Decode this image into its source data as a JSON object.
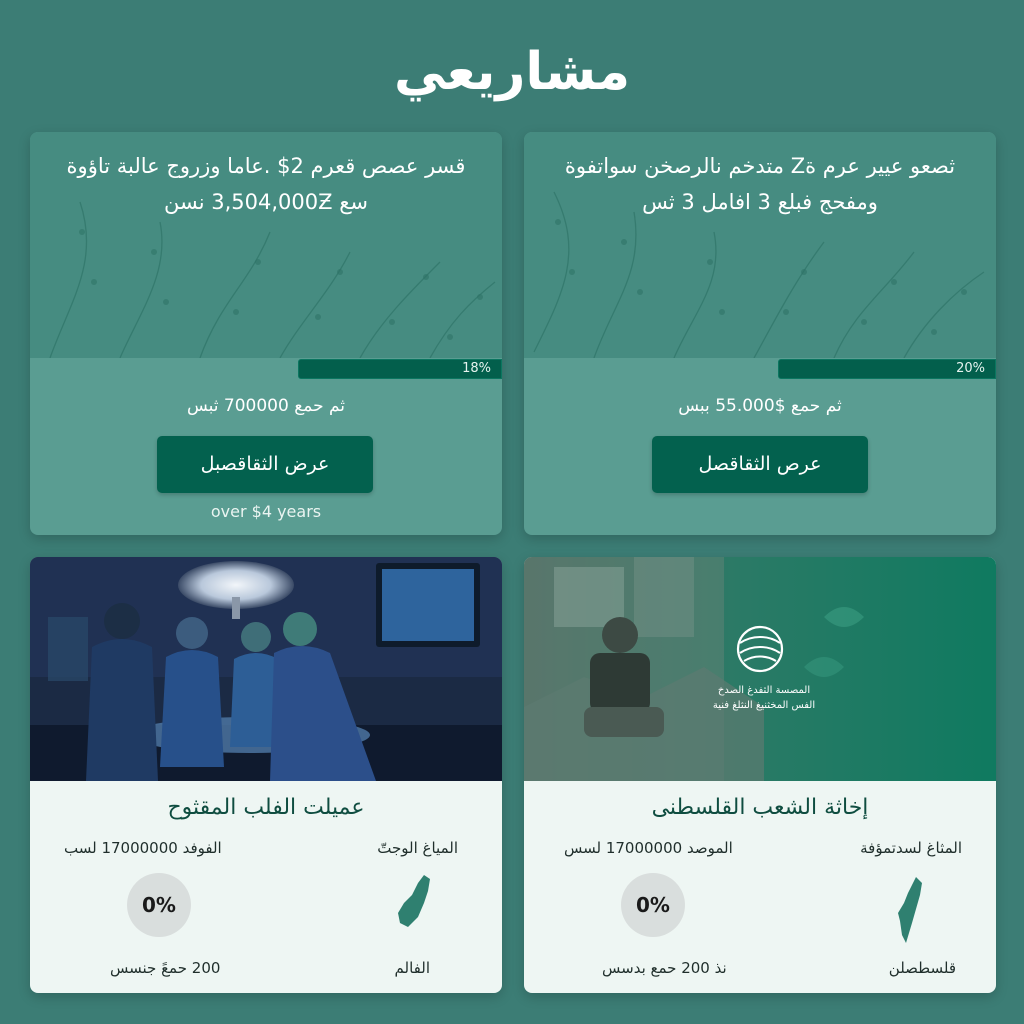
{
  "page": {
    "title": "مشاريعي"
  },
  "projects": [
    {
      "heading": "ثصعو عيير عرم ةZ متدخم نالرصخن سواتفوة ومفحج فبلع 3 افامل 3 ثس",
      "progress_label": "20%",
      "progress_percent": 20,
      "collected": "ثم حمع $55.000 ببس",
      "button_label": "عرص الثقاقصل"
    },
    {
      "heading": "قسر عصص قعرم 2$ .عاما وزروج عالبة تاؤوة سع 3,504,000Ƶ نسن",
      "progress_label": "18%",
      "progress_percent": 18,
      "collected": "ثم حمع 700000 ثبس",
      "button_label": "عرض الثقاقصبل",
      "footnote": "over $4 years"
    },
    {
      "title": "إخاثة الشعب القلسطنى",
      "label_top_right": "المثاغ لسدتمؤفة",
      "label_top_left": "الموصد 17000000 لسس",
      "percent": "0%",
      "label_bottom_right": "قلسطصلن",
      "label_bottom_left": "نذ 200 حمع بدسس",
      "emblem_line_1": "المصسة الثفدغ الصدخ",
      "emblem_line_2": "الفس المخثنيغ النثلغ فنية"
    },
    {
      "title": "عميلت الفلب المقثوح",
      "label_top_right": "المياغ الوجتّ",
      "label_top_left": "الفوفد 17000000 لسب",
      "percent": "0%",
      "label_bottom_right": "الفالم",
      "label_bottom_left": "200 حمعً جنسس"
    }
  ],
  "colors": {
    "background": "#3c7d75",
    "card_top": "#5a9d92",
    "button": "#03614e",
    "card_bottom": "#eef6f3"
  }
}
